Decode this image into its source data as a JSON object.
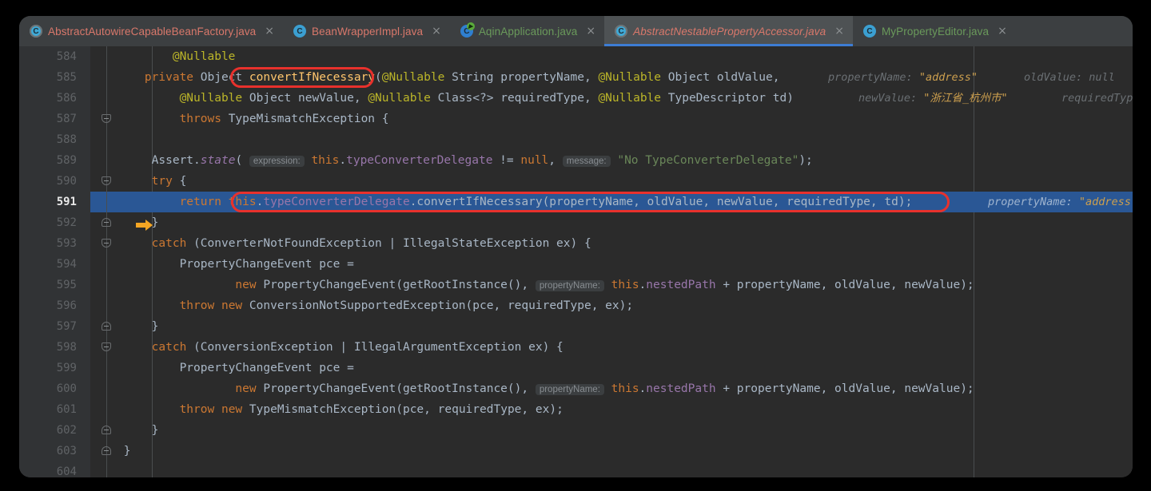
{
  "window": {
    "title": "AbstractNestablePropertyAccessor.java"
  },
  "tabs": [
    {
      "label": "AbstractAutowireCapableBeanFactory.java",
      "icon": "java-class-icon",
      "color": "#d9786b",
      "active": false,
      "close": "×"
    },
    {
      "label": "BeanWrapperImpl.java",
      "icon": "java-class-icon",
      "color": "#d9786b",
      "active": false,
      "close": "×"
    },
    {
      "label": "AqinApplication.java",
      "icon": "spring-boot-run-icon",
      "color": "#6a9a5b",
      "active": false,
      "close": "×"
    },
    {
      "label": "AbstractNestablePropertyAccessor.java",
      "icon": "java-class-icon",
      "color": "#d9786b",
      "active": true,
      "close": "×"
    },
    {
      "label": "MyPropertyEditor.java",
      "icon": "java-class-icon",
      "color": "#6a9a5b",
      "active": false,
      "close": "×"
    }
  ],
  "editor": {
    "current_line": 591,
    "execution_pointer_icon": "execution-pointer-arrow",
    "first_line": 584,
    "last_line": 604,
    "lines": [
      {
        "n": "584"
      },
      {
        "n": "585"
      },
      {
        "n": "586"
      },
      {
        "n": "587",
        "fold": "down"
      },
      {
        "n": "588"
      },
      {
        "n": "589"
      },
      {
        "n": "590",
        "fold": "down"
      },
      {
        "n": "591",
        "highlight": true
      },
      {
        "n": "592",
        "fold": "up"
      },
      {
        "n": "593",
        "fold": "down"
      },
      {
        "n": "594"
      },
      {
        "n": "595"
      },
      {
        "n": "596"
      },
      {
        "n": "597",
        "fold": "up"
      },
      {
        "n": "598",
        "fold": "down"
      },
      {
        "n": "599"
      },
      {
        "n": "600"
      },
      {
        "n": "601"
      },
      {
        "n": "602",
        "fold": "up"
      },
      {
        "n": "603",
        "fold": "up"
      },
      {
        "n": "604"
      }
    ],
    "code": {
      "l584": "@Nullable",
      "l585": "private Object convertIfNecessary(@Nullable String propertyName, @Nullable Object oldValue,",
      "l586": "@Nullable Object newValue, @Nullable Class<?> requiredType, @Nullable TypeDescriptor td)",
      "l587": "throws TypeMismatchException {",
      "l589": "Assert.state( expression: this.typeConverterDelegate != null, message: \"No TypeConverterDelegate\");",
      "l590": "try {",
      "l591": "return this.typeConverterDelegate.convertIfNecessary(propertyName, oldValue, newValue, requiredType, td);",
      "l592": "}",
      "l593": "catch (ConverterNotFoundException | IllegalStateException ex) {",
      "l594": "PropertyChangeEvent pce =",
      "l595": "new PropertyChangeEvent(getRootInstance(), propertyName: this.nestedPath + propertyName, oldValue, newValue);",
      "l596": "throw new ConversionNotSupportedException(pce, requiredType, ex);",
      "l597": "}",
      "l598": "catch (ConversionException | IllegalArgumentException ex) {",
      "l599": "PropertyChangeEvent pce =",
      "l600": "new PropertyChangeEvent(getRootInstance(), propertyName: this.nestedPath + propertyName, oldValue, newValue);",
      "l601": "throw new TypeMismatchException(pce, requiredType, ex);",
      "l602": "}",
      "l603": "}"
    },
    "tokens": {
      "at_nullable": "@Nullable",
      "private": "private",
      "object": "Object",
      "convert_if_necessary": "convertIfNecessary",
      "string": "String",
      "property_name": "propertyName",
      "old_value": "oldValue",
      "new_value": "newValue",
      "class_q": "Class<?>",
      "required_type": "requiredType",
      "type_descriptor": "TypeDescriptor",
      "td": "td",
      "throws": "throws",
      "type_mismatch_exception": "TypeMismatchException",
      "assert": "Assert",
      "state": "state",
      "this": "this",
      "type_converter_delegate": "typeConverterDelegate",
      "null": "null",
      "no_tcd_message": "\"No TypeConverterDelegate\"",
      "try": "try",
      "return": "return",
      "catch": "catch",
      "converter_not_found_exception": "ConverterNotFoundException",
      "illegal_state_exception": "IllegalStateException",
      "conversion_exception": "ConversionException",
      "illegal_argument_exception": "IllegalArgumentException",
      "ex": "ex",
      "property_change_event": "PropertyChangeEvent",
      "pce": "pce",
      "new": "new",
      "get_root_instance": "getRootInstance()",
      "nested_path": "nestedPath",
      "throw": "throw",
      "conversion_not_supported_exception": "ConversionNotSupportedException"
    },
    "param_hints": {
      "expression": "expression:",
      "message": "message:",
      "property_name": "propertyName:"
    },
    "debug_hints": {
      "l585_property_name_label": "propertyName:",
      "l585_property_name_value": "\"address\"",
      "l585_old_value_label": "oldValue:",
      "l585_old_value_value": "null",
      "l586_new_value_label": "newValue:",
      "l586_new_value_value": "\"浙江省_杭州市\"",
      "l586_required_type_label": "requiredType:",
      "l591_property_name_label": "propertyName:",
      "l591_property_name_value": "\"address\""
    },
    "annotations": [
      {
        "name": "oval-method-name",
        "target": "convertIfNecessary",
        "color": "#e8312c"
      },
      {
        "name": "oval-delegate-call",
        "target": "this.typeConverterDelegate.convertIfNecessary(propertyName, oldValue, newValue, requiredType, td)",
        "color": "#e8312c"
      }
    ]
  },
  "colors": {
    "background": "#2b2b2b",
    "gutter": "#313335",
    "tab_bar": "#3c3f41",
    "active_tab": "#4e5254",
    "active_tab_underline": "#3d7dd4",
    "selection": "#2a5795",
    "annotation": "#e8312c",
    "keyword": "#cc7832",
    "string": "#6a8759",
    "annotation_token": "#bbb529",
    "field": "#9876aa",
    "method": "#ffc66d",
    "default_text": "#a9b7c6"
  }
}
